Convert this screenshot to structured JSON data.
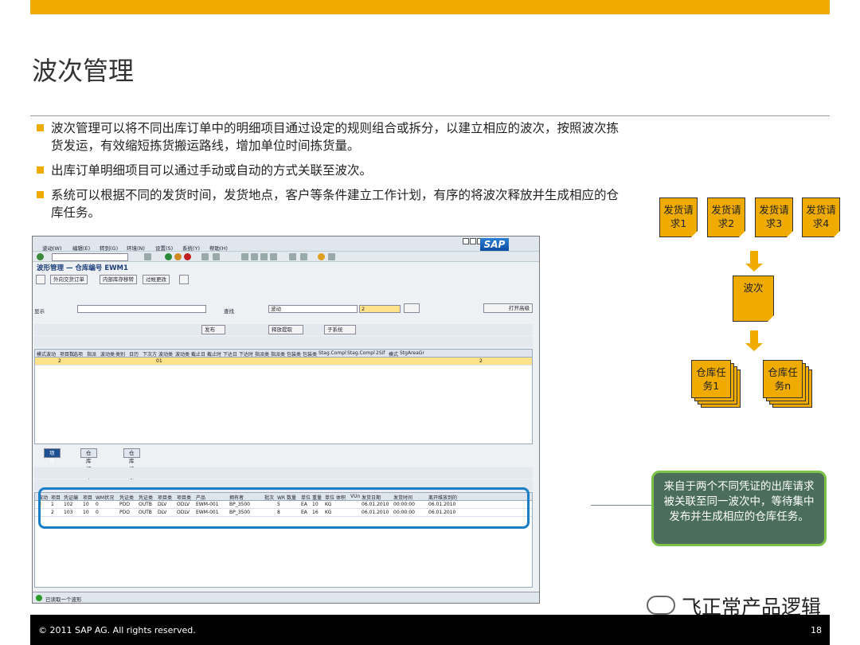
{
  "slide": {
    "title": "波次管理",
    "bullets": [
      "波次管理可以将不同出库订单中的明细项目通过设定的规则组合或拆分，以建立相应的波次，按照波次拣货发运，有效缩短拣货搬运路线，增加单位时间拣货量。",
      "出库订单明细项目可以通过手动或自动的方式关联至波次。",
      "系统可以根据不同的发货时间，发货地点，客户等条件建立工作计划，有序的将波次释放并生成相应的仓库任务。"
    ],
    "footer_copyright": "© 2011 SAP AG. All rights reserved.",
    "page_number": "18",
    "watermark": "飞正常产品逻辑",
    "accent_color": "#f0ab00"
  },
  "diagram": {
    "requests": [
      "发货请求1",
      "发货请求2",
      "发货请求3",
      "发货请求4"
    ],
    "wave": "波次",
    "tasks": [
      "仓库任务1",
      "仓库任务n"
    ],
    "callout": "来自于两个不同凭证的出库请求被关联至同一波次中，等待集中发布并生成相应的仓库任务。"
  },
  "sap": {
    "menu": [
      "波动(W)",
      "编辑(E)",
      "转到(G)",
      "环境(N)",
      "设置(S)",
      "系统(Y)",
      "帮助(H)"
    ],
    "logo": "SAP",
    "page_title": "波形管理 — 仓库编号 EWM1",
    "app_buttons": [
      "外向交货订单",
      "内部库存移转",
      "过帐更改"
    ],
    "display_label": "显示",
    "find_label": "查找",
    "find_value": "波动",
    "find_num": "2",
    "open_button": "打开高级",
    "toolbar_buttons": [
      "发布",
      "释放提取",
      "子系统"
    ],
    "upper_headers": [
      "模式",
      "波动",
      "项目数",
      "选项",
      "指派",
      "波动类",
      "类别",
      "日历",
      "下次方",
      "波动类",
      "波动类",
      "截止日",
      "截止时",
      "下达日",
      "下达时",
      "指派类",
      "指派类",
      "包装类",
      "包装类",
      "Stag.Compl",
      "Stag.Compl",
      "2Sif",
      "模式",
      "StgAreaGr"
    ],
    "upper_row": {
      "wave": "2",
      "cal": "01",
      "num": "2"
    },
    "tabs": [
      "项目",
      "仓库订单",
      "仓库请求"
    ],
    "lower_headers": [
      "波动",
      "项目",
      "凭证编",
      "项目",
      "WM状况",
      "凭证类",
      "凭证类",
      "项目类",
      "项目类",
      "产品",
      "拥有者",
      "批次",
      "WR 数量",
      "单位",
      "重量",
      "单位",
      "体积",
      "VUn",
      "发货日期",
      "发货时间",
      "离开维放到的"
    ],
    "lower_rows": [
      [
        "2",
        "1",
        "102",
        "10",
        "0",
        "PDO",
        "OUTB",
        "DLV",
        "ODLV",
        "EWM-001",
        "BP_3500",
        "",
        "5",
        "EA",
        "10",
        "KG",
        "",
        "",
        "06.01.2010",
        "00:00:00",
        "06.01.2010"
      ],
      [
        "2",
        "2",
        "103",
        "10",
        "0",
        "PDO",
        "OUTB",
        "DLV",
        "ODLV",
        "EWM-001",
        "BP_3500",
        "",
        "8",
        "EA",
        "16",
        "KG",
        "",
        "",
        "06.01.2010",
        "00:00:00",
        "06.01.2010"
      ]
    ],
    "status": "已读取一个波形"
  }
}
